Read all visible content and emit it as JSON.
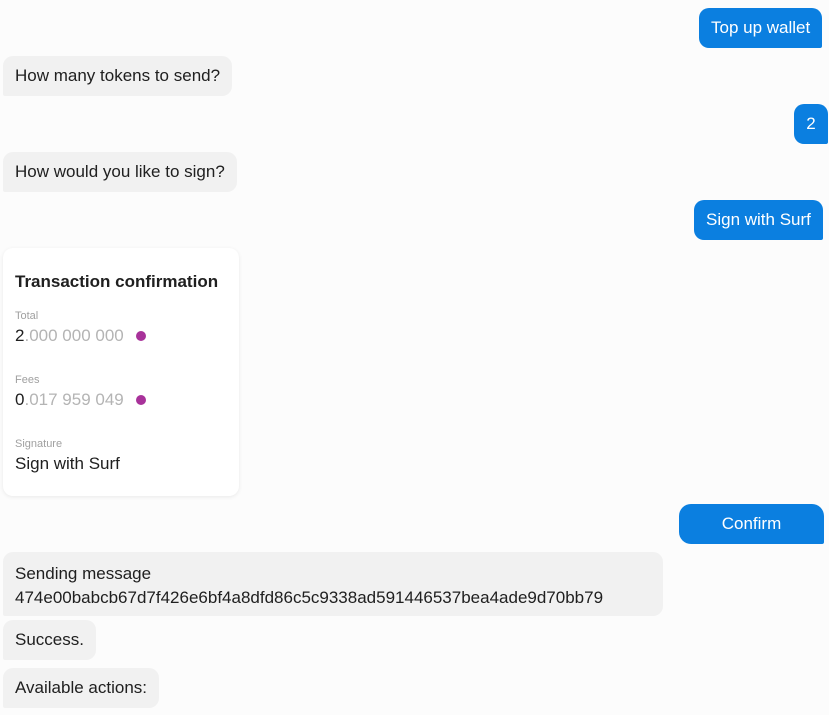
{
  "messages": {
    "top_up": "Top up wallet",
    "how_many_tokens": "How many tokens to send?",
    "amount_reply": "2",
    "how_sign": "How would you like to sign?",
    "sign_reply": "Sign with Surf",
    "sending_label": "Sending message",
    "sending_hash": "474e00babcb67d7f426e6bf4a8dfd86c5c9338ad591446537bea4ade9d70bb79",
    "success": "Success.",
    "available_actions": "Available actions:"
  },
  "confirmation_card": {
    "title": "Transaction confirmation",
    "total_label": "Total",
    "total_int": "2",
    "total_frac": ".000 000 000",
    "fees_label": "Fees",
    "fees_int": "0",
    "fees_frac": ".017 959 049",
    "signature_label": "Signature",
    "signature_value": "Sign with Surf",
    "token_icon": "token-dot-icon",
    "token_color": "#a8329a"
  },
  "confirm_button": {
    "label": "Confirm"
  },
  "colors": {
    "outgoing_bubble": "#0b7fe0",
    "incoming_bubble": "#f1f1f1",
    "background": "#fcfcfc"
  }
}
